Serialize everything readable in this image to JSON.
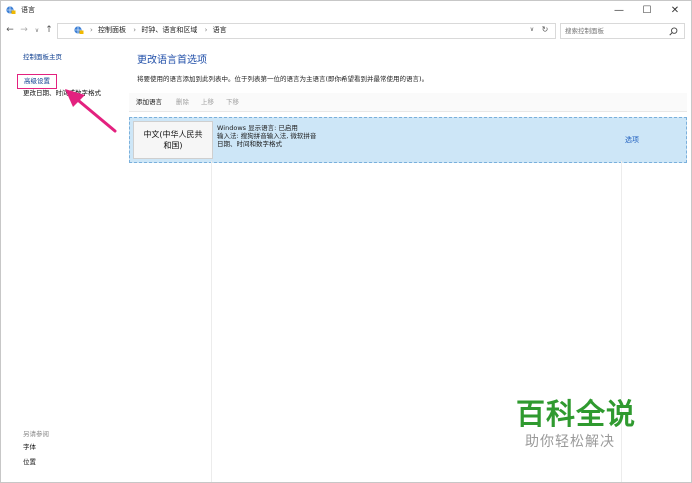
{
  "window": {
    "title": "语言",
    "minimize_glyph": "—",
    "maximize_glyph": "☐",
    "close_glyph": "✕"
  },
  "address_bar": {
    "back_glyph": "←",
    "forward_glyph": "→",
    "recent_glyph": "∨",
    "up_glyph": "↑",
    "breadcrumbs": [
      "控制面板",
      "时钟、语言和区域",
      "语言"
    ],
    "separator": "›",
    "dropdown_glyph": "∨",
    "refresh_glyph": "↻",
    "search_placeholder": "搜索控制面板"
  },
  "sidebar": {
    "home": "控制面板主页",
    "advanced": "高级设置",
    "date_format": "更改日期、时间或数字格式",
    "see_also": "另请参阅",
    "fonts": "字体",
    "location": "位置"
  },
  "main": {
    "title": "更改语言首选项",
    "description": "将要使用的语言添加到此列表中。位于列表第一位的语言为主语言(即你希望看到并最常使用的语言)。",
    "toolbar": {
      "add": "添加语言",
      "remove": "删除",
      "move_up": "上移",
      "move_down": "下移"
    },
    "languages": [
      {
        "name_line1": "中文(中华人民共",
        "name_line2": "和国)",
        "detail_line1": "Windows 显示语言: 已启用",
        "detail_line2": "输入法: 搜狗拼音输入法, 微软拼音",
        "detail_line3": "日期、时间和数字格式",
        "options": "选项"
      }
    ]
  },
  "watermark": {
    "title": "百科全说",
    "subtitle": "助你轻松解决"
  },
  "colors": {
    "accent": "#1f4ea8",
    "highlight_box": "#e3217f",
    "selection": "#cde6f7",
    "watermark_green": "#2f9a2f"
  },
  "icons": {
    "app": "globe-language-icon",
    "search": "magnifier-icon",
    "annotation": "pink-arrow-icon"
  }
}
